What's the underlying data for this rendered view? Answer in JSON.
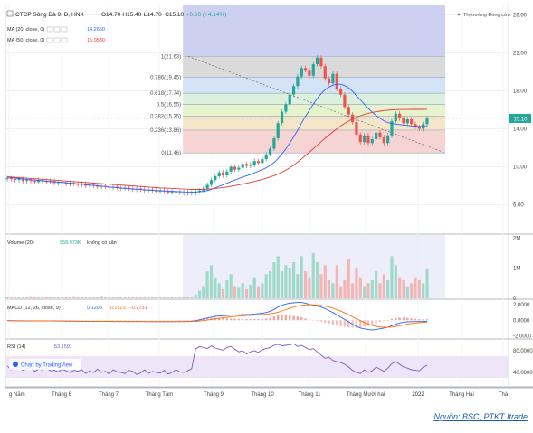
{
  "header": {
    "symbol": "CTCP Sông Đà 9, D, HNX",
    "ohlc": [
      "O14.70",
      "H15.40",
      "L14.70",
      "C15.10",
      "+0.60 (+4.14%)"
    ],
    "ma20_label": "MA (20, close, 0)",
    "ma20_value": "14.2650",
    "ma50_label": "MA (50, close, 0)",
    "ma50_value": "16.0580",
    "market_status": "Thị trường Đóng cửa"
  },
  "volume_panel": {
    "label": "Volume (20)",
    "value": "958.973K",
    "note": "không có sẵn"
  },
  "macd_panel": {
    "label": "MACD (12, 26, close, 9)",
    "values": [
      "0.1208",
      "-0.1523",
      "-0.2731"
    ]
  },
  "rsi_panel": {
    "label": "RSI (14)",
    "value": "53.1591"
  },
  "watermark": "Chart by TradingView",
  "source": "Nguồn: BSC, PTKT Itrade",
  "current_price_tag": "15.10",
  "colors": {
    "up": "#26a69a",
    "down": "#ef5350",
    "ma20": "#2962ff",
    "ma50": "#e53935",
    "macd": "#2962ff",
    "signal": "#ff6d00",
    "rsi": "#7e57c2"
  },
  "chart_data": [
    {
      "type": "candlestick",
      "title": "CTCP Sông Đà 9, D, HNX",
      "x_ticks": [
        "g Năm",
        "Tháng 6",
        "Tháng 7",
        "Tháng Tám",
        "Tháng 9",
        "Tháng 10",
        "Tháng 11",
        "Tháng Mười hai",
        "2022",
        "Tháng Hai",
        "Thá"
      ],
      "y_ticks": [
        "26.00",
        "22.00",
        "18.00",
        "14.00",
        "10.00",
        "6.00"
      ],
      "ylim": [
        3,
        27
      ],
      "fibonacci": [
        {
          "label": "1(21.63)",
          "value": 21.63,
          "color": "#d6d6d6"
        },
        {
          "label": "0.786(19.45)",
          "value": 19.45,
          "color": "#cfe0f5"
        },
        {
          "label": "0.618(17.74)",
          "value": 17.74,
          "color": "#d8eedb"
        },
        {
          "label": "0.5(16.55)",
          "value": 16.55,
          "color": "#e4f2c8"
        },
        {
          "label": "0.382(15.35)",
          "value": 15.35,
          "color": "#f3e3c2"
        },
        {
          "label": "0.236(13.86)",
          "value": 13.86,
          "color": "#f6cfcf"
        },
        {
          "label": "0(11.46)",
          "value": 11.46,
          "color": "#ffffff"
        }
      ],
      "series": [
        {
          "name": "price",
          "values": [
            8.8,
            8.7,
            8.6,
            8.7,
            8.5,
            8.6,
            8.5,
            8.4,
            8.6,
            8.5,
            8.4,
            8.5,
            8.3,
            8.4,
            8.3,
            8.2,
            8.3,
            8.2,
            8.1,
            8.2,
            8.0,
            8.1,
            8.0,
            7.9,
            8.0,
            7.9,
            7.8,
            7.9,
            7.8,
            7.7,
            7.8,
            7.7,
            7.6,
            7.7,
            7.6,
            7.5,
            7.6,
            7.5,
            7.4,
            7.5,
            7.4,
            7.3,
            7.4,
            7.3,
            7.3,
            7.2,
            7.3,
            7.2,
            7.4,
            7.5,
            7.7,
            8.1,
            8.6,
            9.0,
            9.4,
            9.1,
            9.5,
            10.0,
            9.7,
            9.9,
            10.3,
            10.1,
            10.2,
            10.6,
            10.4,
            10.8,
            11.3,
            11.9,
            13.0,
            14.6,
            15.8,
            16.6,
            17.6,
            18.5,
            19.5,
            20.4,
            20.2,
            19.6,
            20.8,
            21.5,
            20.6,
            19.3,
            18.8,
            19.8,
            18.2,
            17.6,
            16.3,
            15.5,
            14.7,
            13.4,
            12.6,
            13.3,
            12.5,
            12.9,
            13.6,
            13.1,
            12.5,
            13.3,
            14.8,
            15.6,
            15.1,
            14.6,
            15.0,
            14.5,
            14.2,
            14.0,
            14.5,
            15.1
          ]
        },
        {
          "name": "MA (20, close, 0)",
          "values": [
            8.9,
            8.85,
            8.8,
            8.76,
            8.72,
            8.68,
            8.64,
            8.6,
            8.56,
            8.52,
            8.48,
            8.45,
            8.42,
            8.39,
            8.36,
            8.32,
            8.28,
            8.24,
            8.2,
            8.16,
            8.12,
            8.08,
            8.04,
            8.0,
            7.96,
            7.92,
            7.88,
            7.84,
            7.8,
            7.76,
            7.73,
            7.7,
            7.67,
            7.64,
            7.61,
            7.58,
            7.55,
            7.52,
            7.5,
            7.48,
            7.46,
            7.44,
            7.42,
            7.4,
            7.38,
            7.36,
            7.35,
            7.34,
            7.35,
            7.37,
            7.42,
            7.5,
            7.62,
            7.78,
            7.95,
            8.1,
            8.27,
            8.45,
            8.6,
            8.76,
            8.92,
            9.06,
            9.2,
            9.36,
            9.52,
            9.7,
            9.9,
            10.14,
            10.45,
            10.85,
            11.35,
            11.9,
            12.5,
            13.15,
            13.85,
            14.6,
            15.3,
            15.95,
            16.6,
            17.2,
            17.7,
            18.1,
            18.4,
            18.6,
            18.7,
            18.7,
            18.55,
            18.3,
            17.95,
            17.5,
            17.05,
            16.6,
            16.15,
            15.75,
            15.4,
            15.1,
            14.85,
            14.65,
            14.55,
            14.5,
            14.45,
            14.4,
            14.35,
            14.3,
            14.28,
            14.26,
            14.26,
            14.27
          ]
        },
        {
          "name": "MA (50, close, 0)",
          "values": [
            8.95,
            8.92,
            8.89,
            8.86,
            8.83,
            8.8,
            8.77,
            8.74,
            8.71,
            8.68,
            8.65,
            8.62,
            8.59,
            8.56,
            8.53,
            8.5,
            8.47,
            8.44,
            8.41,
            8.38,
            8.35,
            8.32,
            8.29,
            8.26,
            8.23,
            8.2,
            8.17,
            8.14,
            8.11,
            8.08,
            8.05,
            8.02,
            7.99,
            7.96,
            7.93,
            7.9,
            7.87,
            7.84,
            7.81,
            7.78,
            7.76,
            7.74,
            7.72,
            7.7,
            7.68,
            7.66,
            7.64,
            7.63,
            7.62,
            7.62,
            7.63,
            7.65,
            7.68,
            7.72,
            7.77,
            7.82,
            7.88,
            7.95,
            8.02,
            8.1,
            8.18,
            8.27,
            8.36,
            8.46,
            8.56,
            8.67,
            8.79,
            8.92,
            9.07,
            9.24,
            9.43,
            9.65,
            9.9,
            10.18,
            10.49,
            10.83,
            11.18,
            11.53,
            11.9,
            12.28,
            12.65,
            13.0,
            13.34,
            13.68,
            14.0,
            14.3,
            14.57,
            14.82,
            15.04,
            15.22,
            15.38,
            15.52,
            15.63,
            15.72,
            15.8,
            15.86,
            15.92,
            15.96,
            16.0,
            16.02,
            16.03,
            16.04,
            16.04,
            16.05,
            16.05,
            16.05,
            16.05,
            16.06
          ]
        }
      ]
    },
    {
      "type": "bar",
      "title": "Volume (20)",
      "y_ticks": [
        "2M",
        "1M",
        "0"
      ],
      "ylim": [
        0,
        2.1
      ],
      "series": [
        {
          "name": "Volume (20)",
          "values": [
            0.05,
            0.04,
            0.06,
            0.03,
            0.05,
            0.04,
            0.07,
            0.05,
            0.04,
            0.06,
            0.05,
            0.04,
            0.03,
            0.05,
            0.06,
            0.04,
            0.05,
            0.07,
            0.06,
            0.05,
            0.04,
            0.06,
            0.05,
            0.04,
            0.08,
            0.05,
            0.04,
            0.06,
            0.05,
            0.04,
            0.05,
            0.06,
            0.04,
            0.05,
            0.03,
            0.04,
            0.05,
            0.06,
            0.04,
            0.05,
            0.04,
            0.05,
            0.06,
            0.05,
            0.04,
            0.05,
            0.04,
            0.06,
            0.12,
            0.25,
            0.4,
            0.9,
            1.1,
            0.7,
            0.5,
            0.3,
            0.6,
            0.8,
            0.4,
            0.35,
            0.5,
            0.3,
            0.45,
            0.7,
            0.4,
            0.5,
            0.8,
            0.9,
            1.2,
            1.4,
            0.9,
            1.1,
            1.0,
            1.2,
            0.8,
            1.4,
            0.9,
            0.7,
            1.5,
            1.2,
            0.8,
            1.1,
            0.6,
            0.5,
            1.1,
            0.4,
            0.6,
            1.3,
            0.5,
            1.0,
            0.7,
            0.4,
            0.5,
            0.6,
            0.9,
            0.5,
            0.8,
            0.6,
            1.4,
            1.1,
            0.7,
            0.6,
            0.4,
            0.5,
            0.7,
            0.6,
            0.5,
            0.96
          ]
        }
      ]
    },
    {
      "type": "line",
      "title": "MACD (12, 26, close, 9)",
      "y_ticks": [
        "2.0000",
        "0.0000",
        "-2.0000"
      ],
      "ylim": [
        -2.3,
        2.6
      ],
      "series": [
        {
          "name": "MACD",
          "values": [
            -0.05,
            -0.06,
            -0.07,
            -0.07,
            -0.08,
            -0.08,
            -0.09,
            -0.09,
            -0.1,
            -0.1,
            -0.1,
            -0.1,
            -0.11,
            -0.11,
            -0.11,
            -0.12,
            -0.12,
            -0.12,
            -0.13,
            -0.13,
            -0.13,
            -0.14,
            -0.14,
            -0.14,
            -0.15,
            -0.15,
            -0.15,
            -0.16,
            -0.16,
            -0.16,
            -0.16,
            -0.17,
            -0.17,
            -0.17,
            -0.17,
            -0.17,
            -0.18,
            -0.18,
            -0.18,
            -0.18,
            -0.18,
            -0.18,
            -0.18,
            -0.18,
            -0.17,
            -0.16,
            -0.14,
            -0.12,
            -0.05,
            0.05,
            0.18,
            0.3,
            0.4,
            0.5,
            0.55,
            0.58,
            0.62,
            0.66,
            0.68,
            0.7,
            0.72,
            0.74,
            0.76,
            0.8,
            0.85,
            0.9,
            1.0,
            1.15,
            1.4,
            1.7,
            1.95,
            2.1,
            2.2,
            2.25,
            2.3,
            2.3,
            2.2,
            2.05,
            1.95,
            1.85,
            1.7,
            1.5,
            1.25,
            1.0,
            0.7,
            0.4,
            0.1,
            -0.2,
            -0.5,
            -0.8,
            -1.0,
            -1.1,
            -1.2,
            -1.25,
            -1.2,
            -1.1,
            -1.0,
            -0.9,
            -0.7,
            -0.5,
            -0.35,
            -0.25,
            -0.2,
            -0.18,
            -0.17,
            -0.16,
            -0.15,
            -0.15
          ]
        },
        {
          "name": "Signal",
          "values": [
            -0.04,
            -0.05,
            -0.05,
            -0.06,
            -0.06,
            -0.07,
            -0.07,
            -0.08,
            -0.08,
            -0.09,
            -0.09,
            -0.09,
            -0.1,
            -0.1,
            -0.1,
            -0.11,
            -0.11,
            -0.11,
            -0.12,
            -0.12,
            -0.12,
            -0.13,
            -0.13,
            -0.13,
            -0.14,
            -0.14,
            -0.14,
            -0.15,
            -0.15,
            -0.15,
            -0.15,
            -0.16,
            -0.16,
            -0.16,
            -0.16,
            -0.16,
            -0.17,
            -0.17,
            -0.17,
            -0.17,
            -0.17,
            -0.17,
            -0.17,
            -0.17,
            -0.17,
            -0.17,
            -0.16,
            -0.15,
            -0.13,
            -0.1,
            -0.05,
            0.02,
            0.1,
            0.18,
            0.25,
            0.32,
            0.38,
            0.44,
            0.49,
            0.53,
            0.57,
            0.6,
            0.63,
            0.66,
            0.7,
            0.74,
            0.78,
            0.84,
            0.92,
            1.04,
            1.2,
            1.38,
            1.55,
            1.7,
            1.82,
            1.92,
            1.98,
            2.0,
            1.99,
            1.96,
            1.9,
            1.82,
            1.7,
            1.55,
            1.38,
            1.18,
            0.96,
            0.72,
            0.45,
            0.2,
            -0.05,
            -0.28,
            -0.48,
            -0.65,
            -0.78,
            -0.86,
            -0.9,
            -0.9,
            -0.88,
            -0.8,
            -0.7,
            -0.6,
            -0.5,
            -0.42,
            -0.35,
            -0.3,
            -0.27,
            -0.27
          ]
        }
      ]
    },
    {
      "type": "line",
      "title": "RSI (14)",
      "y_ticks": [
        "80.0000",
        "40.0000"
      ],
      "ylim": [
        15,
        100
      ],
      "series": [
        {
          "name": "RSI (14)",
          "values": [
            52,
            45,
            48,
            50,
            44,
            47,
            49,
            42,
            46,
            45,
            48,
            43,
            44,
            41,
            46,
            43,
            40,
            44,
            42,
            45,
            38,
            43,
            40,
            46,
            40,
            42,
            37,
            45,
            41,
            40,
            38,
            44,
            42,
            36,
            39,
            45,
            38,
            42,
            40,
            39,
            44,
            37,
            40,
            45,
            41,
            40,
            43,
            47,
            83,
            88,
            86,
            84,
            89,
            85,
            83,
            81,
            86,
            88,
            83,
            78,
            80,
            74,
            78,
            80,
            77,
            82,
            84,
            86,
            90,
            92,
            89,
            90,
            91,
            93,
            88,
            90,
            86,
            82,
            84,
            78,
            72,
            66,
            68,
            62,
            60,
            58,
            55,
            50,
            44,
            40,
            38,
            45,
            40,
            43,
            50,
            46,
            42,
            48,
            56,
            60,
            55,
            50,
            48,
            45,
            44,
            43,
            50,
            53
          ]
        }
      ]
    }
  ]
}
